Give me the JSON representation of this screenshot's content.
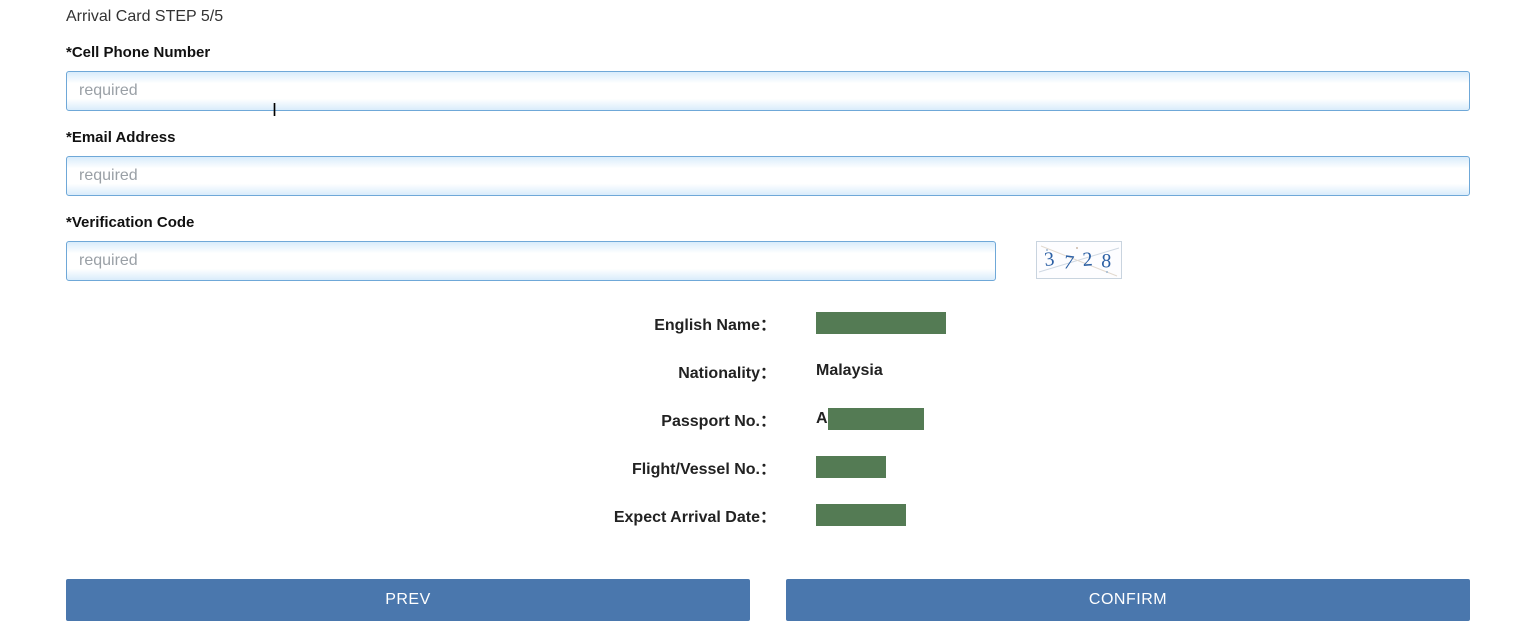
{
  "header": {
    "title": "Arrival Card STEP 5/5"
  },
  "fields": {
    "phone": {
      "label": "*Cell Phone Number",
      "placeholder": "required",
      "value": ""
    },
    "email": {
      "label": "*Email Address",
      "placeholder": "required",
      "value": ""
    },
    "verification": {
      "label": "*Verification Code",
      "placeholder": "required",
      "value": ""
    }
  },
  "captcha": {
    "digits": "3728"
  },
  "summary": {
    "english_name": {
      "label": "English Name：",
      "value_prefix": ""
    },
    "nationality": {
      "label": "Nationality：",
      "value": "Malaysia"
    },
    "passport": {
      "label": "Passport No.：",
      "value_prefix": "A"
    },
    "flight": {
      "label": "Flight/Vessel No.：",
      "value_prefix": ""
    },
    "arrival_date": {
      "label": "Expect Arrival Date：",
      "value_prefix": ""
    }
  },
  "buttons": {
    "prev": "PREV",
    "confirm": "CONFIRM"
  }
}
